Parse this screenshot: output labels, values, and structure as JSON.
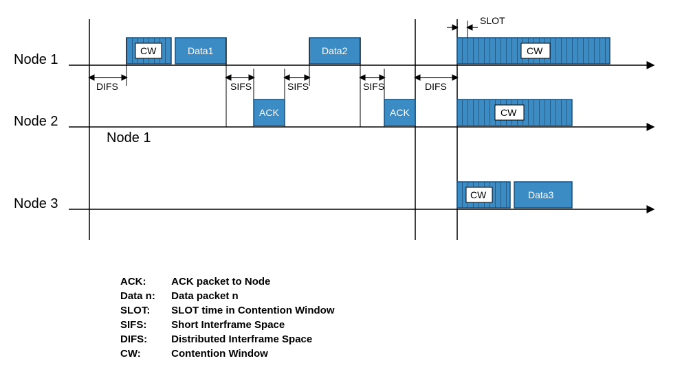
{
  "nodes": {
    "n1": "Node 1",
    "n2": "Node 2",
    "n3": "Node 3",
    "n1_sub": "Node 1"
  },
  "packets": {
    "cw": "CW",
    "data1": "Data1",
    "data2": "Data2",
    "data3": "Data3",
    "ack": "ACK"
  },
  "intervals": {
    "difs": "DIFS",
    "sifs": "SIFS",
    "slot": "SLOT"
  },
  "legend": {
    "ack_k": "ACK:",
    "ack_v": "ACK packet to Node",
    "data_k": "Data n:",
    "data_v": "Data packet n",
    "slot_k": "SLOT:",
    "slot_v": "SLOT time in Contention Window",
    "sifs_k": "SIFS:",
    "sifs_v": "Short Interframe Space",
    "difs_k": "DIFS:",
    "difs_v": "Distributed Interframe Space",
    "cw_k": "CW:",
    "cw_v": "Contention Window"
  },
  "chart_data": {
    "type": "timing-diagram",
    "title": "CSMA/CA timing with DIFS, SIFS, SLOT, Contention Window, Data and ACK",
    "lanes": [
      "Node 1",
      "Node 2",
      "Node 3"
    ],
    "time_origin": 130,
    "events": [
      {
        "lane": "Node 1",
        "kind": "interval",
        "name": "DIFS",
        "from": 130,
        "to": 184
      },
      {
        "lane": "Node 1",
        "kind": "block",
        "name": "CW",
        "from": 184,
        "to": 249
      },
      {
        "lane": "Node 1",
        "kind": "block",
        "name": "Data1",
        "from": 255,
        "to": 329
      },
      {
        "lane": "Node 1",
        "kind": "interval",
        "name": "SIFS",
        "from": 329,
        "to": 369
      },
      {
        "lane": "Node 2",
        "kind": "block",
        "name": "ACK",
        "from": 369,
        "to": 414
      },
      {
        "lane": "Node 1",
        "kind": "interval",
        "name": "SIFS",
        "from": 414,
        "to": 450
      },
      {
        "lane": "Node 1",
        "kind": "block",
        "name": "Data2",
        "from": 450,
        "to": 524
      },
      {
        "lane": "Node 1",
        "kind": "interval",
        "name": "SIFS",
        "from": 524,
        "to": 559
      },
      {
        "lane": "Node 2",
        "kind": "block",
        "name": "ACK",
        "from": 559,
        "to": 604
      },
      {
        "lane": "*",
        "kind": "interval",
        "name": "DIFS",
        "from": 604,
        "to": 665
      },
      {
        "lane": "*",
        "kind": "interval",
        "name": "SLOT",
        "from": 665,
        "to": 680
      },
      {
        "lane": "Node 1",
        "kind": "block",
        "name": "CW",
        "from": 665,
        "to": 887
      },
      {
        "lane": "Node 2",
        "kind": "block",
        "name": "CW",
        "from": 665,
        "to": 832
      },
      {
        "lane": "Node 3",
        "kind": "block",
        "name": "CW",
        "from": 665,
        "to": 742
      },
      {
        "lane": "Node 3",
        "kind": "block",
        "name": "Data3",
        "from": 748,
        "to": 832
      }
    ]
  }
}
